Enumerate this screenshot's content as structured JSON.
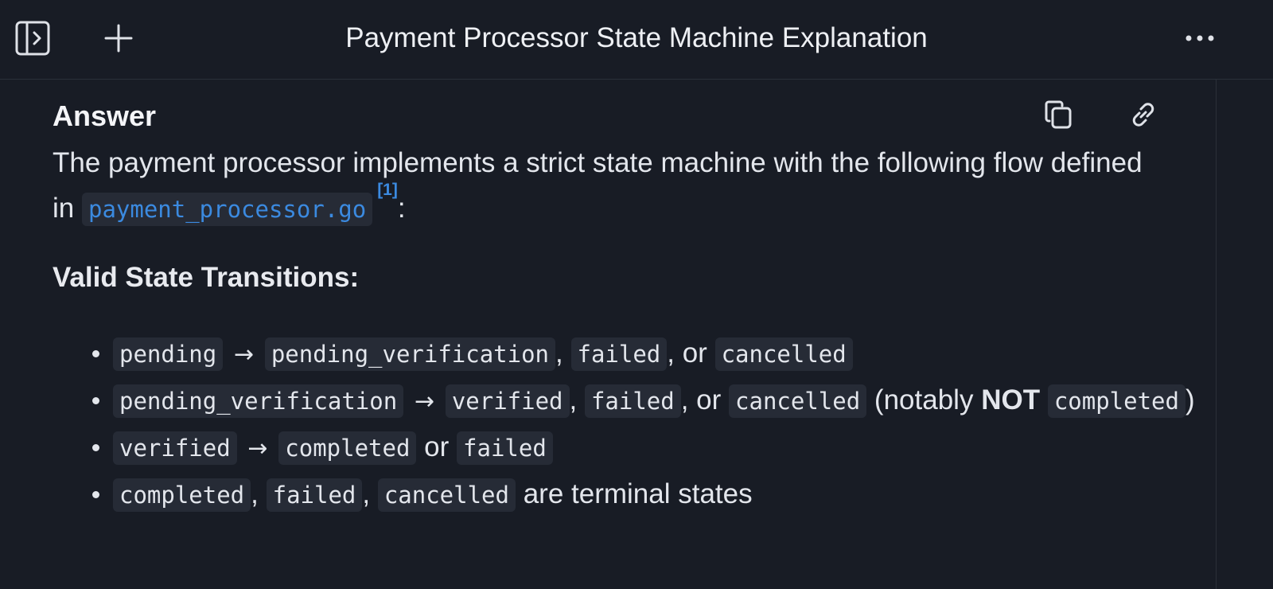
{
  "header": {
    "title": "Payment Processor State Machine Explanation",
    "icons": {
      "sidebar": "sidebar-toggle-icon",
      "new": "plus-icon",
      "more": "ellipsis-icon"
    }
  },
  "answer": {
    "heading": "Answer",
    "icons": {
      "copy": "copy-icon",
      "link": "link-icon"
    },
    "intro_text": "The payment processor implements a strict state machine with the following flow defined in",
    "intro_file": "payment_processor.go",
    "intro_citation": "[1]",
    "intro_end": ":",
    "section_heading": "Valid State Transitions:",
    "arrow": "→",
    "transitions": [
      {
        "from": "pending",
        "to1": "pending_verification",
        "sep1": ",",
        "to2": "failed",
        "sep2": ", or",
        "to3": "cancelled"
      },
      {
        "from": "pending_verification",
        "to1": "verified",
        "sep1": ",",
        "to2": "failed",
        "sep2": ", or",
        "to3": "cancelled",
        "note_open": "(notably",
        "note_bold": "NOT",
        "note_code": "completed",
        "note_close": ")"
      },
      {
        "from": "verified",
        "to1": "completed",
        "sep1": "or",
        "to2": "failed"
      },
      {
        "s1": "completed",
        "sep1": ",",
        "s2": "failed",
        "sep2": ",",
        "s3": "cancelled",
        "suffix": "are terminal states"
      }
    ]
  },
  "colors": {
    "background": "#181c25",
    "code_bg": "#262b36",
    "link": "#3b8ae0",
    "text": "#e3e6ec"
  }
}
